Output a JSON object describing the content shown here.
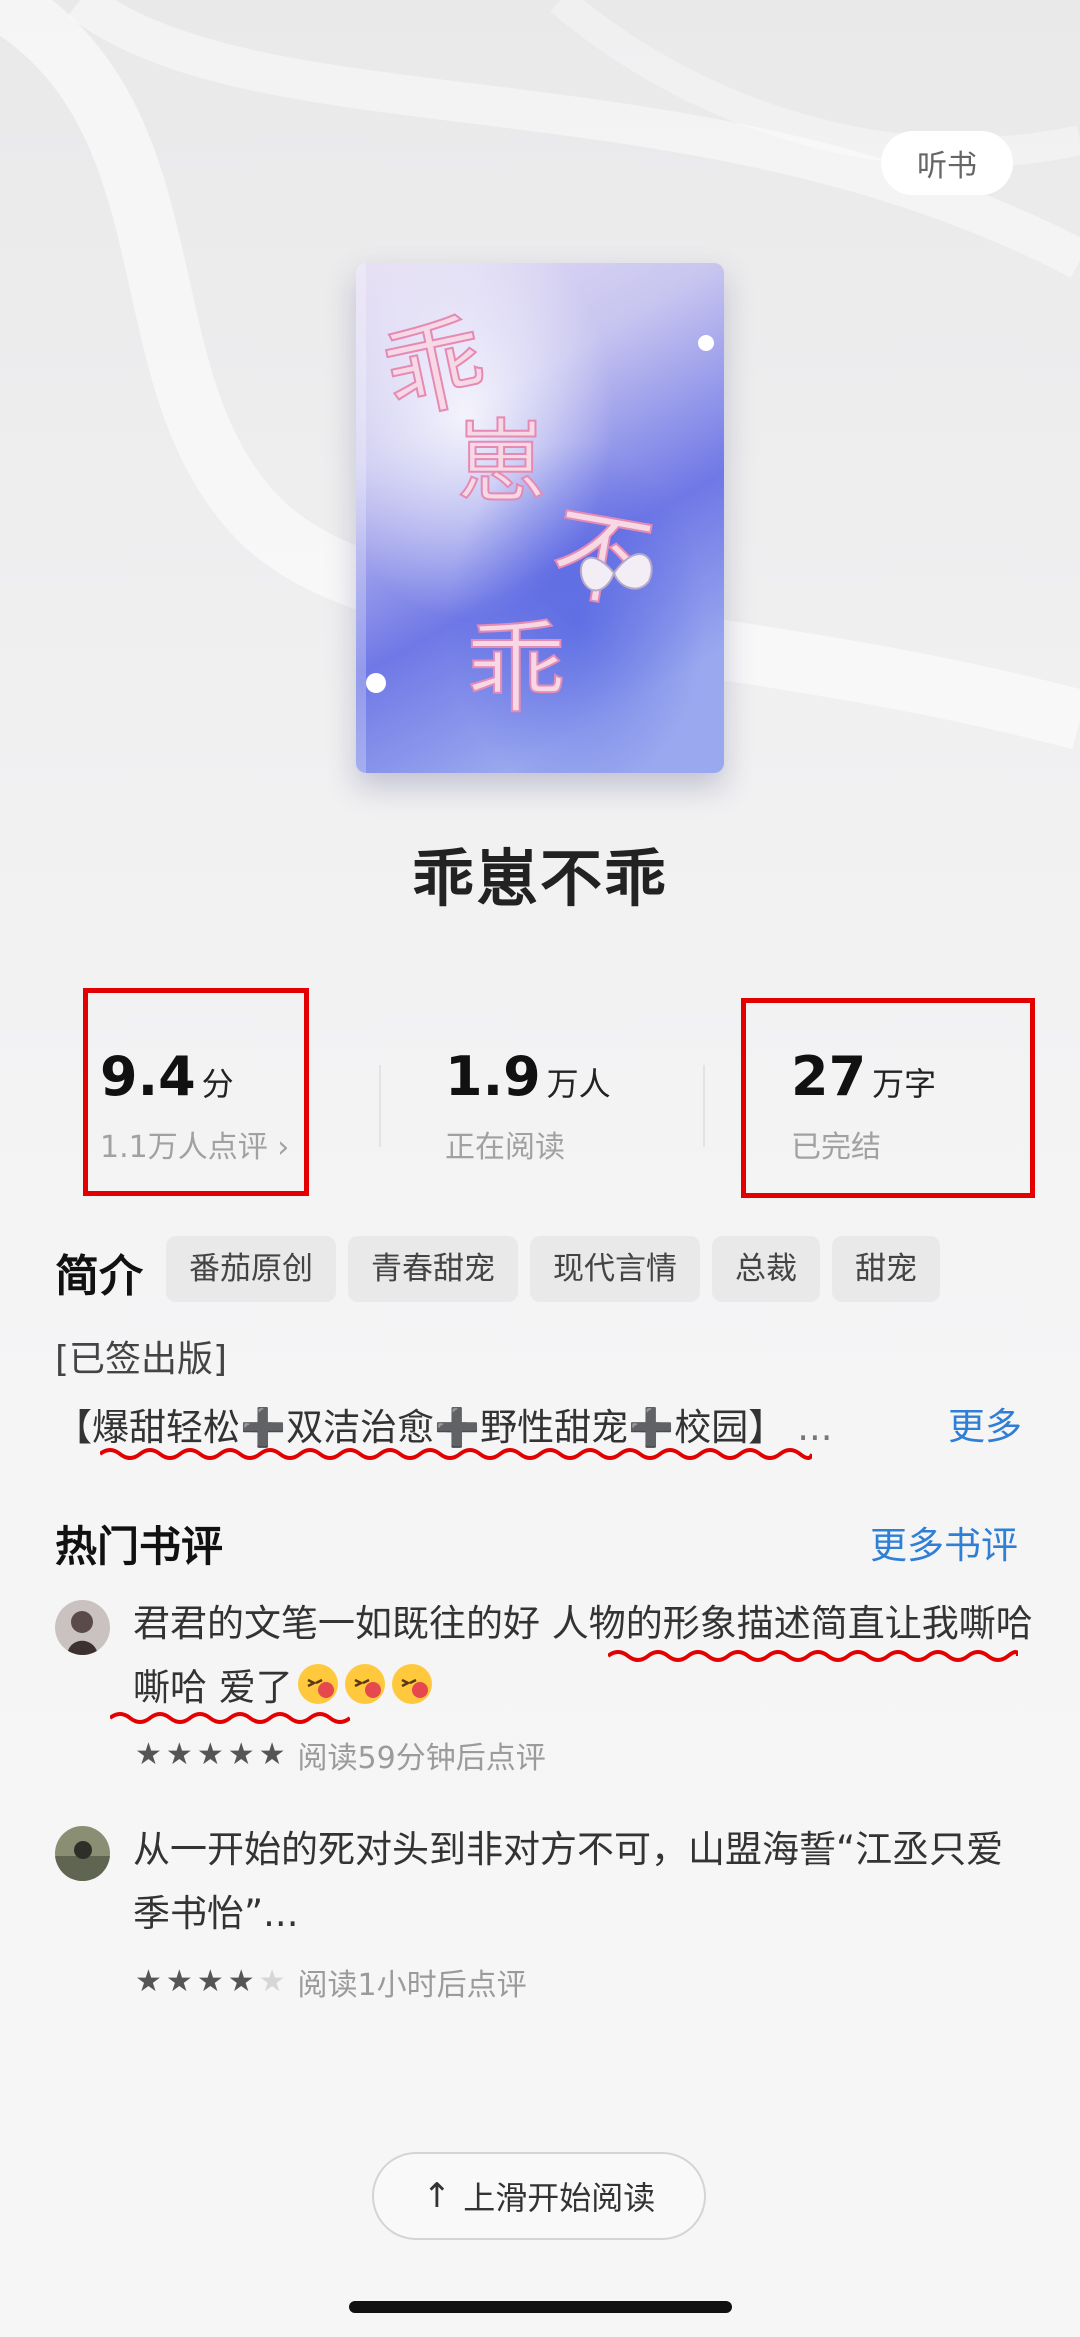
{
  "header": {
    "listen_label": "听书"
  },
  "book": {
    "title": "乖崽不乖",
    "cover_chars": [
      "乖",
      "崽",
      "不",
      "乖"
    ]
  },
  "stats": {
    "rating": {
      "value": "9.4",
      "unit": "分",
      "sub": "1.1万人点评"
    },
    "readers": {
      "value": "1.9",
      "unit": "万人",
      "sub": "正在阅读"
    },
    "words": {
      "value": "27",
      "unit": "万字",
      "sub": "已完结"
    }
  },
  "intro": {
    "label": "简介",
    "tags": [
      "番茄原创",
      "青春甜宠",
      "现代言情",
      "总裁",
      "甜宠"
    ],
    "signed": "[已签出版]",
    "summary": "【爆甜轻松➕双洁治愈➕野性甜宠➕校园】",
    "ellipsis": "...",
    "more_label": "更多"
  },
  "reviews": {
    "title": "热门书评",
    "more_label": "更多书评",
    "items": [
      {
        "text": "君君的文笔一如既往的好  人物的形象描述简直让我嘶哈嘶哈  爱了",
        "stars": 5,
        "meta": "阅读59分钟后点评",
        "emoji": "kissing-face-emoji"
      },
      {
        "text": "从一开始的死对头到非对方不可，山盟海誓“江丞只爱季书怡”...",
        "stars": 4,
        "meta": "阅读1小时后点评"
      }
    ]
  },
  "footer": {
    "start_label": "上滑开始阅读"
  },
  "colors": {
    "accent": "#2f7fd7",
    "annotation_red": "#e20000"
  }
}
